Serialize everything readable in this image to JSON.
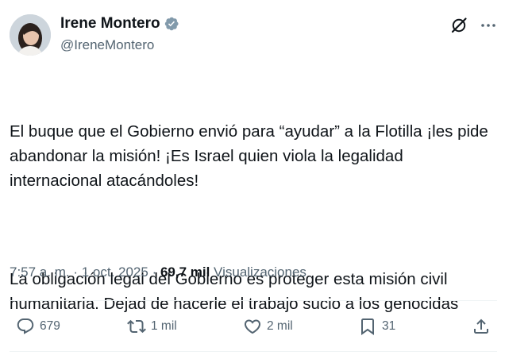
{
  "author": {
    "name": "Irene Montero",
    "handle": "@IreneMontero"
  },
  "icons": {
    "verified": "verified-badge-icon",
    "grok": "grok-icon",
    "more": "more-icon",
    "reply": "reply-icon",
    "repost": "repost-icon",
    "like": "like-icon",
    "bookmark": "bookmark-icon",
    "share": "share-icon"
  },
  "colors": {
    "verified": "#829aab",
    "text": "#0f1419",
    "secondary": "#536471"
  },
  "tweet": {
    "paragraph1": "El buque que el Gobierno envió para “ayudar” a la Flotilla ¡les pide abandonar la misión! ¡Es Israel quien viola la legalidad internacional atacándoles!",
    "paragraph2": "La obligación legal del Gobierno es proteger esta misión civil humanitaria. Dejad de hacerle el trabajo sucio a los genocidas"
  },
  "meta": {
    "time": "7:57 a. m.",
    "sep1": " · ",
    "date": "1 oct. 2025",
    "sep2": " · ",
    "views_count": "69,7 mil",
    "views_label": " Visualizaciones"
  },
  "actions": {
    "replies": "679",
    "reposts": "1 mil",
    "likes": "2 mil",
    "bookmarks": "31"
  }
}
